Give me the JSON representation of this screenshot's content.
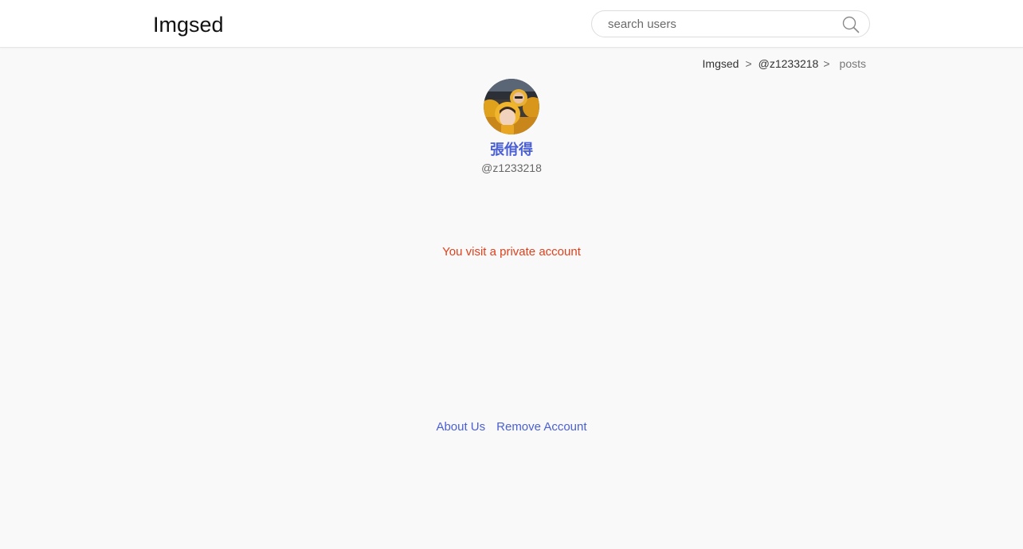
{
  "header": {
    "logo": "Imgsed",
    "search": {
      "placeholder": "search users",
      "value": "",
      "icon": "search-icon"
    }
  },
  "breadcrumb": {
    "items": [
      "Imgsed",
      "@z1233218",
      "posts"
    ],
    "separator": ">"
  },
  "profile": {
    "display_name": "張佾得",
    "username": "@z1233218",
    "avatar_icon": "avatar-photo"
  },
  "main": {
    "message": "You visit a private account"
  },
  "footer": {
    "links": [
      "About Us",
      "Remove Account"
    ]
  },
  "colors": {
    "accent": "#4a5fd6",
    "warning": "#e2401c",
    "background": "#f9f9f9"
  }
}
